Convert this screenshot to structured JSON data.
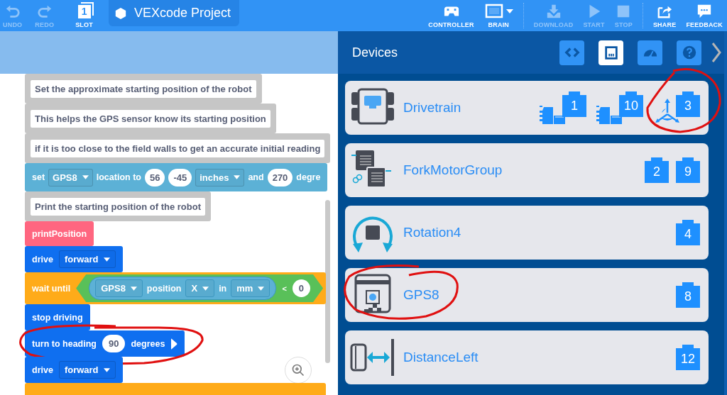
{
  "toolbar": {
    "left": [
      {
        "kind": "undo",
        "label": "UNDO",
        "disabled": true
      },
      {
        "kind": "redo",
        "label": "REDO",
        "disabled": true
      },
      {
        "kind": "slot",
        "label": "SLOT",
        "slot": "1",
        "disabled": false
      }
    ],
    "project_name": "VEXcode Project",
    "right": [
      {
        "kind": "controller",
        "label": "CONTROLLER",
        "disabled": false
      },
      {
        "kind": "brain",
        "label": "BRAIN",
        "disabled": false
      },
      {
        "kind": "download",
        "label": "DOWNLOAD",
        "disabled": true
      },
      {
        "kind": "start",
        "label": "START",
        "disabled": true
      },
      {
        "kind": "stop",
        "label": "STOP",
        "disabled": true
      },
      {
        "kind": "share",
        "label": "SHARE",
        "disabled": false
      },
      {
        "kind": "feedback",
        "label": "FEEDBACK",
        "disabled": false
      }
    ]
  },
  "blocks": [
    {
      "kind": "comment",
      "circled": false,
      "parts": [
        {
          "kind": "field",
          "text": "Set the approximate starting position of the robot"
        }
      ]
    },
    {
      "kind": "comment",
      "circled": false,
      "parts": [
        {
          "kind": "field",
          "text": "This helps the GPS sensor know its starting position"
        }
      ]
    },
    {
      "kind": "comment",
      "circled": false,
      "parts": [
        {
          "kind": "field",
          "text": "if it is too close to the field walls to get an accurate initial reading"
        }
      ]
    },
    {
      "kind": "sensing",
      "circled": false,
      "parts": [
        {
          "kind": "text",
          "text": "set"
        },
        {
          "kind": "dropdown",
          "text": "GPS8"
        },
        {
          "kind": "text",
          "text": "location to"
        },
        {
          "kind": "number",
          "text": "56"
        },
        {
          "kind": "number",
          "text": "-45"
        },
        {
          "kind": "dropdown",
          "text": "inches"
        },
        {
          "kind": "text",
          "text": "and"
        },
        {
          "kind": "number",
          "text": "270"
        },
        {
          "kind": "text",
          "text": "degre"
        }
      ]
    },
    {
      "kind": "comment",
      "circled": false,
      "parts": [
        {
          "kind": "field",
          "text": "Print the starting position of the robot"
        }
      ]
    },
    {
      "kind": "myblock",
      "circled": false,
      "parts": [
        {
          "kind": "text",
          "text": "printPosition"
        }
      ]
    },
    {
      "kind": "drivetrain",
      "circled": false,
      "parts": [
        {
          "kind": "text",
          "text": "drive"
        },
        {
          "kind": "dropdown",
          "text": "forward"
        }
      ]
    },
    {
      "kind": "control",
      "circled": false,
      "parts": [
        {
          "kind": "text",
          "text": "wait until"
        },
        {
          "kind": "condition",
          "parts": [
            {
              "kind": "reporter",
              "parts": [
                {
                  "kind": "dropdown",
                  "text": "GPS8"
                },
                {
                  "kind": "text",
                  "text": "position"
                },
                {
                  "kind": "dropdown",
                  "text": "X"
                },
                {
                  "kind": "text",
                  "text": "in"
                },
                {
                  "kind": "dropdown",
                  "text": "mm"
                }
              ]
            },
            {
              "kind": "small",
              "text": "<"
            },
            {
              "kind": "number",
              "text": "0"
            }
          ]
        }
      ]
    },
    {
      "kind": "drivetrain",
      "circled": false,
      "parts": [
        {
          "kind": "text",
          "text": "stop driving"
        }
      ]
    },
    {
      "kind": "drivetrain",
      "circled": true,
      "parts": [
        {
          "kind": "text",
          "text": "turn to heading"
        },
        {
          "kind": "number",
          "text": "90"
        },
        {
          "kind": "text",
          "text": "degrees"
        },
        {
          "kind": "run"
        }
      ]
    },
    {
      "kind": "drivetrain",
      "circled": false,
      "parts": [
        {
          "kind": "text",
          "text": "drive"
        },
        {
          "kind": "dropdown",
          "text": "forward"
        }
      ]
    },
    {
      "kind": "control",
      "circled": false
    }
  ],
  "panel": {
    "title": "Devices",
    "tabs": [
      {
        "kind": "code",
        "selected": false
      },
      {
        "kind": "devices",
        "selected": true
      },
      {
        "kind": "dashboard",
        "selected": false
      },
      {
        "kind": "help",
        "selected": false
      }
    ],
    "devices": [
      {
        "kind": "drivetrain",
        "name": "Drivetrain",
        "icon_circled": false,
        "ports": [
          {
            "kind": "motor",
            "number": "1",
            "circled": false
          },
          {
            "kind": "motor",
            "number": "10",
            "circled": false
          },
          {
            "kind": "inertial",
            "number": "3",
            "circled": true
          }
        ]
      },
      {
        "kind": "motor_group",
        "name": "ForkMotorGroup",
        "icon_circled": false,
        "ports": [
          {
            "kind": "plain",
            "number": "2",
            "circled": false
          },
          {
            "kind": "plain",
            "number": "9",
            "circled": false
          }
        ]
      },
      {
        "kind": "rotation",
        "name": "Rotation4",
        "icon_circled": false,
        "ports": [
          {
            "kind": "plain",
            "number": "4",
            "circled": false
          }
        ]
      },
      {
        "kind": "gps",
        "name": "GPS8",
        "icon_circled": true,
        "ports": [
          {
            "kind": "plain",
            "number": "8",
            "circled": false
          }
        ]
      },
      {
        "kind": "distance",
        "name": "DistanceLeft",
        "icon_circled": false,
        "ports": [
          {
            "kind": "plain",
            "number": "12",
            "circled": false
          }
        ]
      }
    ]
  }
}
